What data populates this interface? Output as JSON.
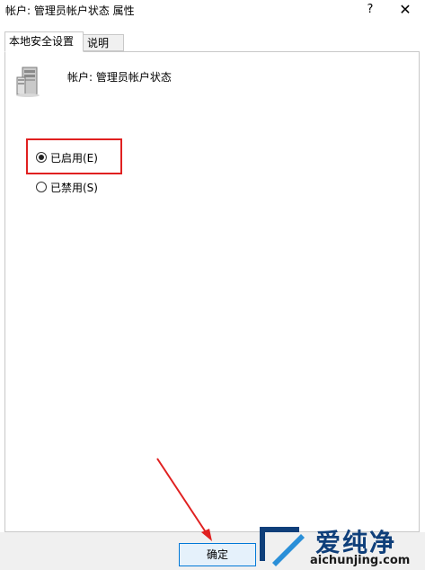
{
  "window": {
    "title": "帐户: 管理员帐户状态 属性",
    "help_glyph": "?",
    "close_glyph": "✕"
  },
  "tabs": [
    {
      "label": "本地安全设置",
      "active": true
    },
    {
      "label": "说明",
      "active": false
    }
  ],
  "policy": {
    "name": "帐户: 管理员帐户状态",
    "icon": "server-icon"
  },
  "options": [
    {
      "label": "已启用(E)",
      "checked": true
    },
    {
      "label": "已禁用(S)",
      "checked": false
    }
  ],
  "footer": {
    "ok_label": "确定"
  },
  "watermark": {
    "text": "爱纯净",
    "url": "aichunjing.com"
  },
  "colors": {
    "highlight": "#e02020",
    "arrow": "#e02020",
    "button_border": "#0078d7",
    "watermark": "#0f3f7a"
  }
}
